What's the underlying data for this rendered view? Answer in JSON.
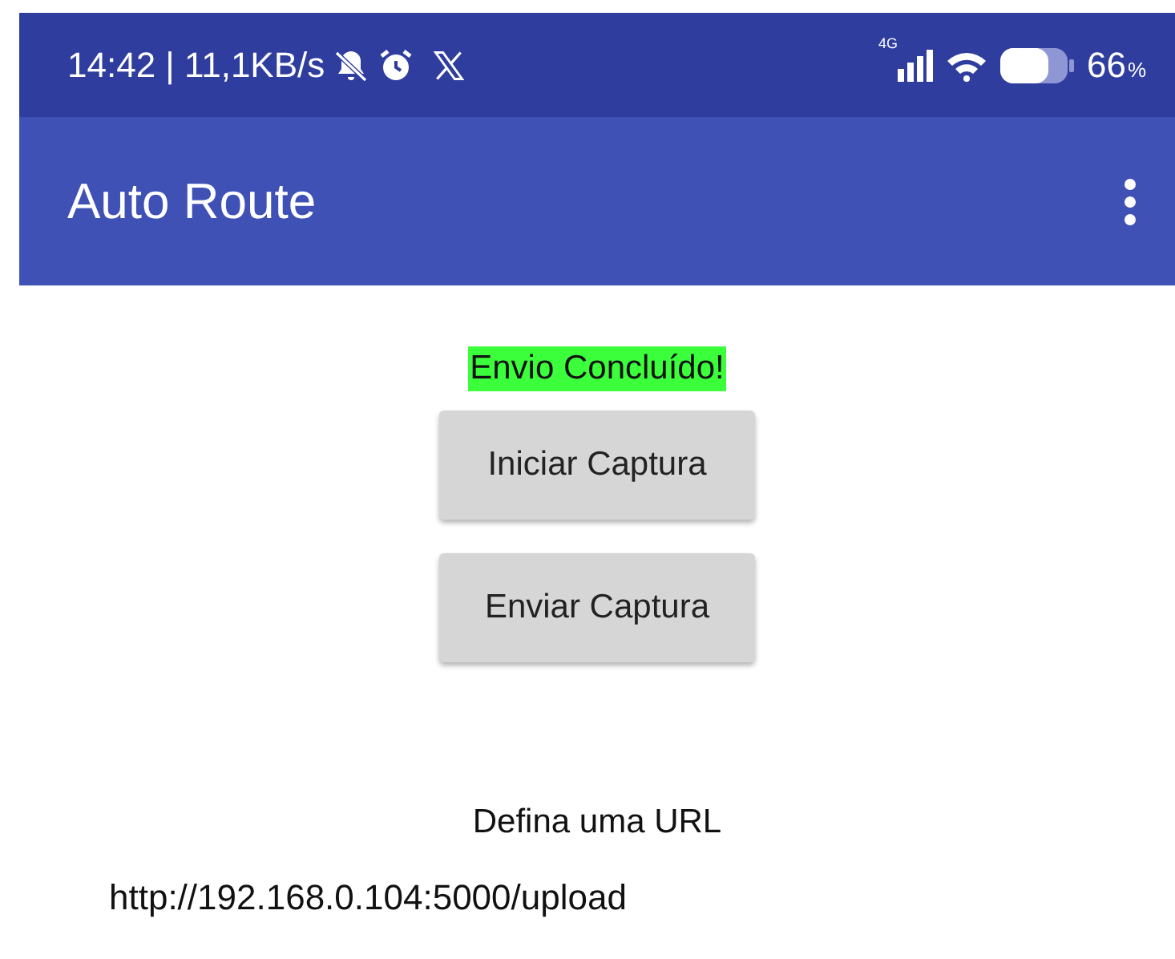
{
  "status_bar": {
    "time": "14:42 | 11,1KB/s",
    "network_type": "4G",
    "battery_percent": "66",
    "battery_unit": "%"
  },
  "app_bar": {
    "title": "Auto Route"
  },
  "status_message": {
    "text": "Envio Concluído!",
    "highlighted": true
  },
  "buttons": [
    {
      "label": "Iniciar Captura"
    },
    {
      "label": "Enviar Captura"
    }
  ],
  "url_label": "Defina uma URL",
  "url_field": {
    "value": "http://192.168.0.104:5000/upload"
  }
}
